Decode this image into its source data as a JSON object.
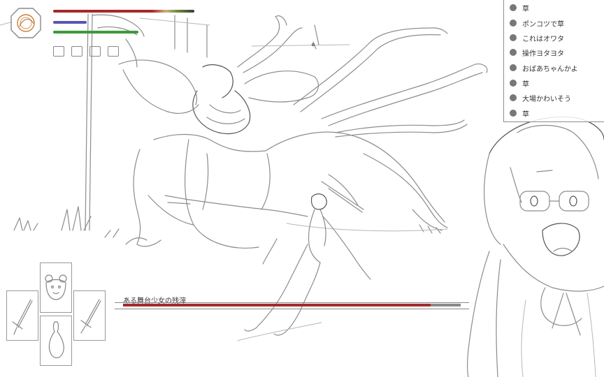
{
  "hud": {
    "hp_fraction": 1.0,
    "fp_fraction": 0.24,
    "stamina_fraction": 0.6,
    "status_slots": 4,
    "colors": {
      "hp": "#a8282b",
      "fp": "#5b54b4",
      "stamina": "#3d9a3a"
    }
  },
  "comments": [
    {
      "text": "草"
    },
    {
      "text": "ポンコツで草"
    },
    {
      "text": "これはオワタ"
    },
    {
      "text": "操作ヨタヨタ"
    },
    {
      "text": "おばあちゃんかよ"
    },
    {
      "text": "草"
    },
    {
      "text": "大場かわいそう"
    },
    {
      "text": "草"
    }
  ],
  "equipment": {
    "top": "bear-mask-icon",
    "left": "sword-icon",
    "right": "sword-icon",
    "bottom": "gourd-icon"
  },
  "boss": {
    "name": "ある舞台少女の残滓",
    "hp_fraction": 0.91,
    "color": "#a52a2e"
  }
}
